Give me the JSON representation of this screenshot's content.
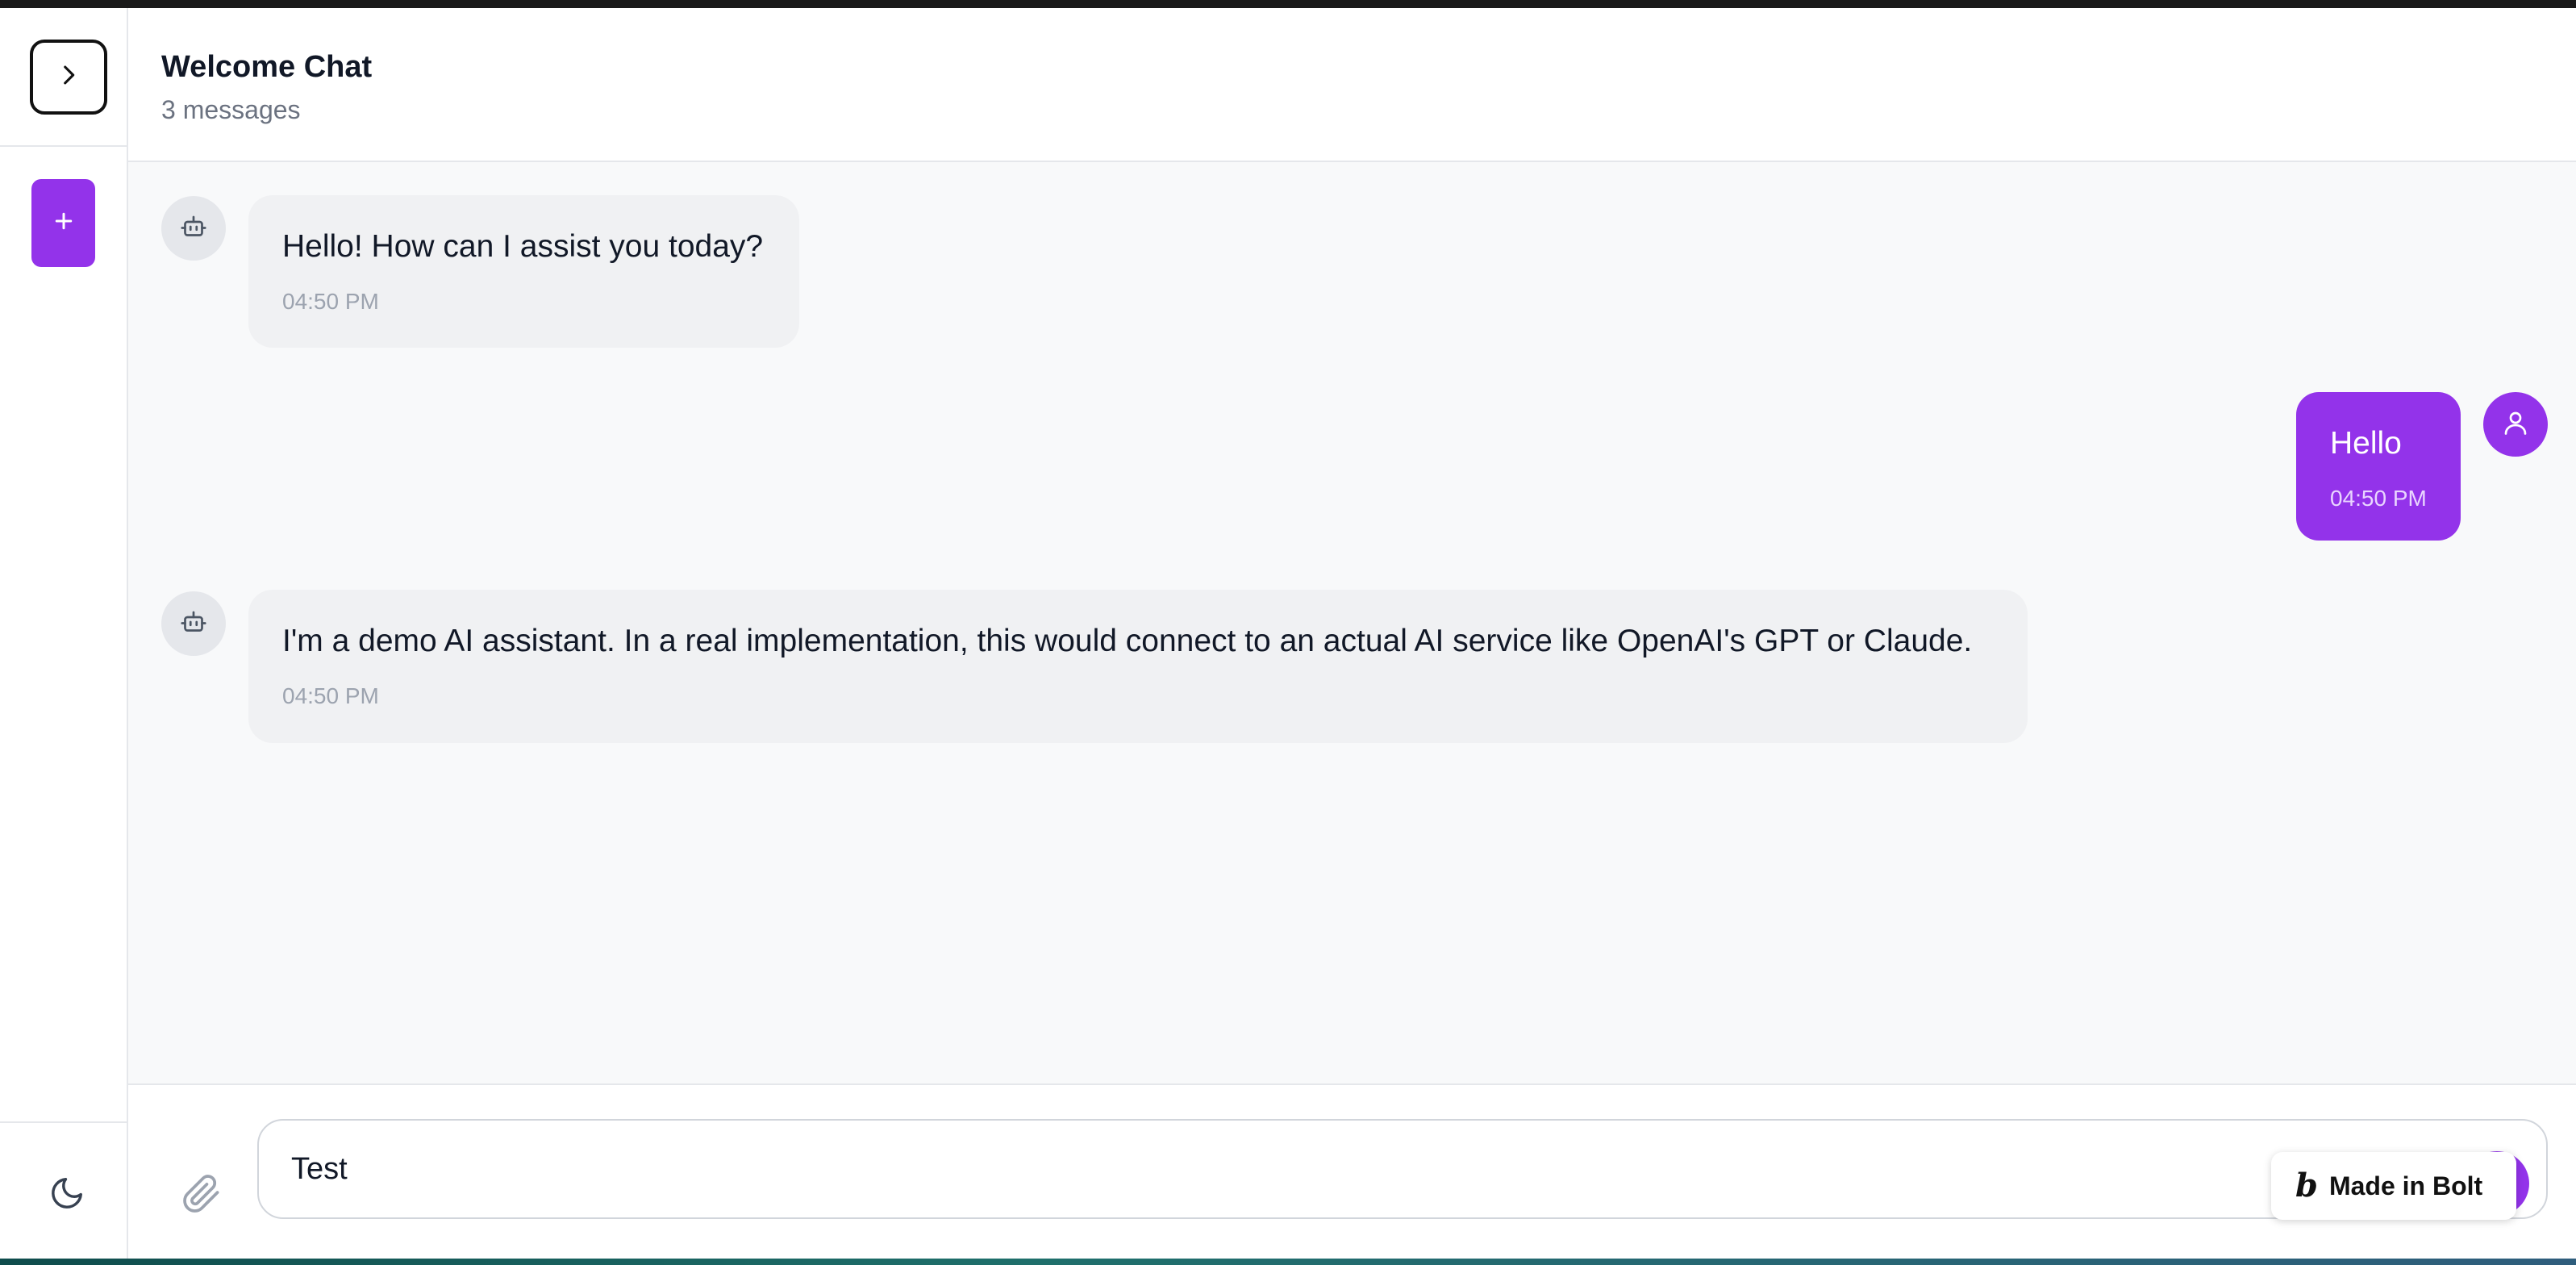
{
  "header": {
    "title": "Welcome Chat",
    "subtitle": "3 messages"
  },
  "messages": [
    {
      "role": "assistant",
      "text": "Hello! How can I assist you today?",
      "time": "04:50 PM"
    },
    {
      "role": "user",
      "text": "Hello",
      "time": "04:50 PM"
    },
    {
      "role": "assistant",
      "text": "I'm a demo AI assistant. In a real implementation, this would connect to an actual AI service like OpenAI's GPT or Claude.",
      "time": "04:50 PM"
    }
  ],
  "input": {
    "value": "Test"
  },
  "badge": {
    "logo": "b",
    "label": "Made in Bolt"
  },
  "icons": {
    "toggle": "chevron-right-icon",
    "new_chat": "plus-icon",
    "theme": "moon-icon",
    "attach": "paperclip-icon",
    "bot": "bot-icon",
    "user": "user-icon"
  },
  "colors": {
    "accent": "#9333ea",
    "bot_bubble": "#f0f1f3",
    "chat_background": "#f8f9fa"
  }
}
